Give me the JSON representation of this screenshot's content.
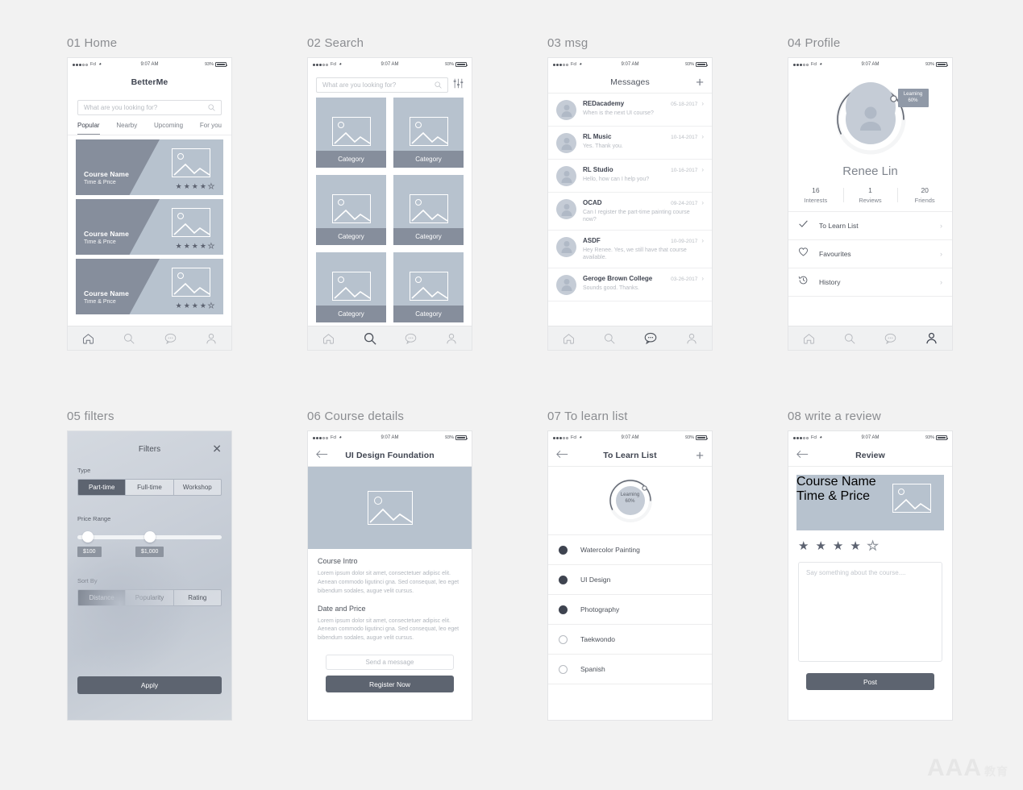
{
  "statusbar": {
    "carrier": "Fcl",
    "time": "9:07 AM",
    "battery": "93%"
  },
  "screens": [
    {
      "caption": "01 Home",
      "nav_title": "BetterMe",
      "search_placeholder": "What are you looking for?",
      "tabs": [
        "Popular",
        "Nearby",
        "Upcoming",
        "For you"
      ],
      "cards": [
        {
          "name": "Course Name",
          "sub": "Time & Price",
          "rating": 4
        },
        {
          "name": "Course Name",
          "sub": "Time & Price",
          "rating": 4
        },
        {
          "name": "Course Name",
          "sub": "Time & Price",
          "rating": 4
        }
      ]
    },
    {
      "caption": "02 Search",
      "search_placeholder": "What are you looking for?",
      "filter_icon": "sliders-icon",
      "categories": [
        "Category",
        "Category",
        "Category",
        "Category",
        "Category",
        "Category"
      ]
    },
    {
      "caption": "03 msg",
      "nav_title": "Messages",
      "add_icon": "plus-icon",
      "messages": [
        {
          "name": "REDacademy",
          "date": "05-18-2017",
          "preview": "When is the next UI course?"
        },
        {
          "name": "RL Music",
          "date": "10-14-2017",
          "preview": "Yes. Thank you."
        },
        {
          "name": "RL Studio",
          "date": "10-16-2017",
          "preview": "Hello, how can I help you?"
        },
        {
          "name": "OCAD",
          "date": "09-24-2017",
          "preview": "Can I register the part-time painting course now?"
        },
        {
          "name": "ASDF",
          "date": "10-09-2017",
          "preview": "Hey Renee. Yes, we still have that course available."
        },
        {
          "name": "Geroge Brown College",
          "date": "03-26-2017",
          "preview": "Sounds good. Thanks."
        }
      ]
    },
    {
      "caption": "04 Profile",
      "badge": "Learning\n60%",
      "badge_line1": "Learning",
      "badge_line2": "60%",
      "name": "Renee Lin",
      "stats": [
        {
          "num": "16",
          "label": "Interests"
        },
        {
          "num": "1",
          "label": "Reviews"
        },
        {
          "num": "20",
          "label": "Friends"
        }
      ],
      "rows": [
        {
          "label": "To Learn List",
          "icon": "check-icon"
        },
        {
          "label": "Favourites",
          "icon": "heart-icon"
        },
        {
          "label": "History",
          "icon": "history-icon"
        }
      ]
    },
    {
      "caption": "05 filters",
      "title": "Filters",
      "close_icon": "close-icon",
      "type_label": "Type",
      "type_options": [
        "Part-time",
        "Full-time",
        "Workshop"
      ],
      "type_selected": "Part-time",
      "price_label": "Price Range",
      "price_min": "$100",
      "price_max": "$1,000",
      "sort_label": "Sort By",
      "sort_options": [
        "Distance",
        "Popularity",
        "Rating"
      ],
      "sort_selected": "Distance",
      "apply_label": "Apply"
    },
    {
      "caption": "06 Course details",
      "nav_title": "UI Design Foundation",
      "back_icon": "arrow-left-icon",
      "intro_title": "Course Intro",
      "intro_body": "Lorem ipsum dolor sit amet, consectetuer adipisc elit. Aenean commodo ligutinci gna. Sed consequat, leo eget bibendum sodales, augue velit cursus.",
      "date_title": "Date and Price",
      "date_body": "Lorem ipsum dolor sit amet, consectetuer adipisc elit. Aenean commodo ligutinci gna. Sed consequat, leo eget bibendum sodales, augue velit cursus.",
      "message_label": "Send a message",
      "register_label": "Register Now"
    },
    {
      "caption": "07 To learn list",
      "nav_title": "To Learn List",
      "badge_line1": "Learning",
      "badge_line2": "60%",
      "items": [
        {
          "label": "Watercolor Painting",
          "done": true
        },
        {
          "label": "UI Design",
          "done": true
        },
        {
          "label": "Photography",
          "done": true
        },
        {
          "label": "Taekwondo",
          "done": false
        },
        {
          "label": "Spanish",
          "done": false
        }
      ]
    },
    {
      "caption": "08 write a review",
      "nav_title": "Review",
      "card_name": "Course Name",
      "card_sub": "Time & Price",
      "rating": 4,
      "textarea_placeholder": "Say something about the course....",
      "post_label": "Post"
    }
  ],
  "tabbar": {
    "items": [
      "home-icon",
      "search-icon",
      "chat-icon",
      "profile-icon"
    ]
  },
  "watermark": {
    "text": "AAA",
    "cn": "教育"
  },
  "colors": {
    "card_light": "#b7c2ce",
    "card_dark": "#868e9c",
    "accent_dark": "#5d6470"
  }
}
